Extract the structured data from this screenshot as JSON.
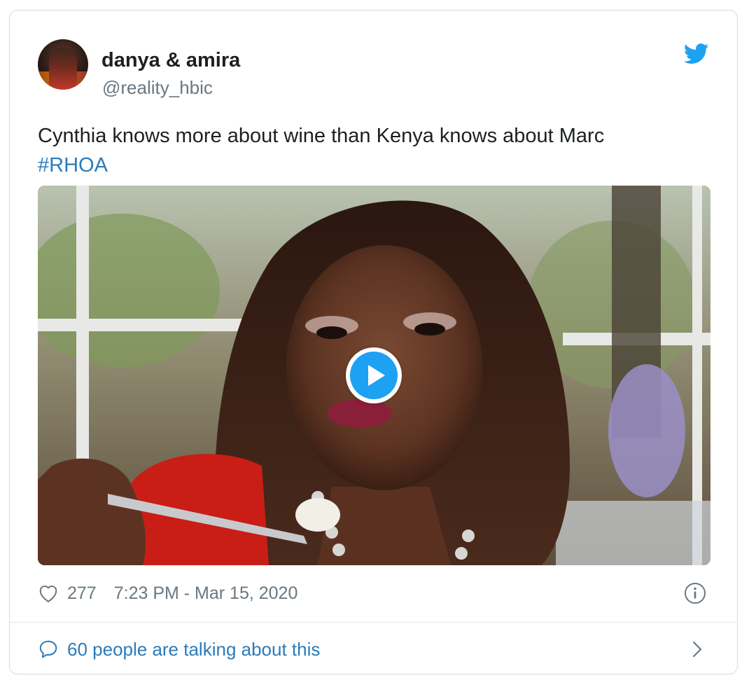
{
  "author": {
    "display_name": "danya & amira",
    "handle": "@reality_hbic"
  },
  "tweet": {
    "text": "Cynthia knows more about wine than Kenya knows about Marc",
    "hashtag": "#RHOA"
  },
  "media": {
    "type": "video",
    "play_icon": "play-icon"
  },
  "footer": {
    "likes": "277",
    "timestamp": "7:23 PM - Mar 15, 2020",
    "heart_icon": "heart-icon",
    "info_icon": "info-icon"
  },
  "conversation": {
    "label": "60 people are talking about this",
    "bubble_icon": "speech-bubble-icon",
    "chevron_icon": "chevron-right-icon"
  },
  "colors": {
    "link": "#2b7bb9",
    "twitter_blue": "#1da1f2",
    "muted_text": "#697882",
    "primary_text": "#1c2022"
  }
}
